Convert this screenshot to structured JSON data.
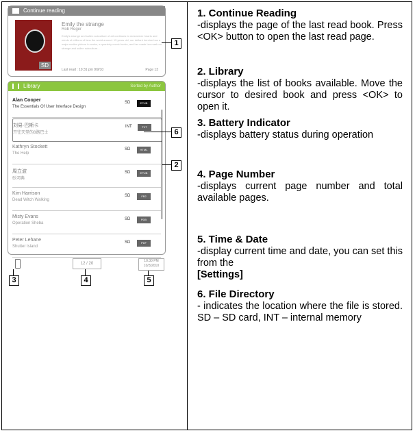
{
  "device": {
    "continue_reading": {
      "header": "Continue reading",
      "book_title": "Emily the strange",
      "book_author": "Rob Reger",
      "blurb": "Emily's strange and sullen subculture of art continues to mesmerize hearts and minds of millions of fans the world around. 13 years old, our defiant heroine has a major motion picture in works, a quarterly comic books, and her made her mark on strange and sullen subculture...",
      "cover_badge": "SD",
      "last_read": "Last read : 10:31 pm  9/9/10",
      "page": "Page 13"
    },
    "library": {
      "header": "Library",
      "sort": "Sorted by Author",
      "books": [
        {
          "title": "Alan Cooper",
          "subtitle": "The Essentials Of User Interface Design",
          "location": "SD",
          "format": "EPUB"
        },
        {
          "title": "刘易·巴斯卡",
          "subtitle": "开往天堂的8路巴士",
          "location": "INT",
          "format": "TXT"
        },
        {
          "title": "Kathryn Stockett",
          "subtitle": "The Help",
          "location": "SD",
          "format": "HTML"
        },
        {
          "title": "周立波",
          "subtitle": "砂河典",
          "location": "SD",
          "format": "EPUB"
        },
        {
          "title": "Kim Harrison",
          "subtitle": "Dead Witch Walking",
          "location": "SD",
          "format": "FB2"
        },
        {
          "title": "Misty Evans",
          "subtitle": "Operation Sheba",
          "location": "SD",
          "format": "PDB"
        },
        {
          "title": "Peter Lehane",
          "subtitle": "Shutter Island",
          "location": "SD",
          "format": "PDF"
        }
      ]
    },
    "status": {
      "page_indicator": "12 / 20",
      "time": "10:30 PM",
      "date": "10/3/2010"
    },
    "callouts": [
      "1",
      "2",
      "3",
      "4",
      "5",
      "6"
    ]
  },
  "sections": [
    {
      "title": "1. Continue Reading",
      "body": "-displays the page of the last read book. Press <OK> button to open the last read page."
    },
    {
      "title": "2. Library",
      "body": "-displays the list of books available. Move the cursor to desired book and press <OK> to open it."
    },
    {
      "title": "3. Battery Indicator",
      "body": "-displays battery status during operation"
    },
    {
      "title": "4. Page Number",
      "body": "-displays current page number and total available pages."
    },
    {
      "title": "5. Time & Date",
      "body": "-display current time and date, you can set this from the",
      "body_bold": "[Settings]"
    },
    {
      "title": "6. File Directory",
      "body": "- indicates the location where the file is stored. SD – SD card, INT – internal memory"
    }
  ]
}
